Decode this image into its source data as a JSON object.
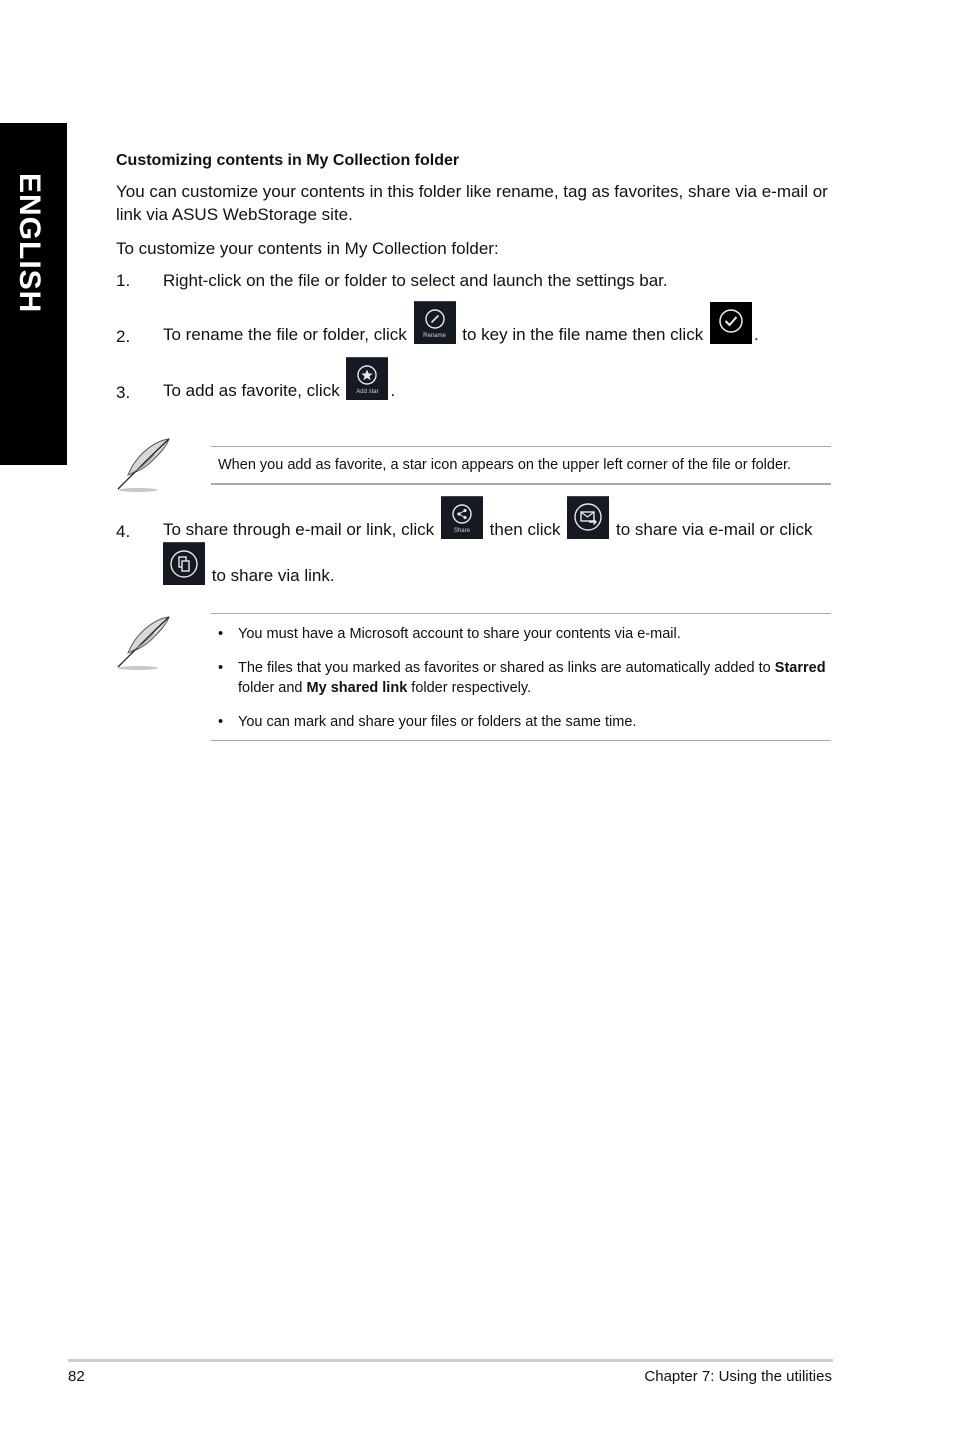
{
  "side_tab": {
    "label": "ENGLISH"
  },
  "section": {
    "heading": "Customizing contents in My Collection folder",
    "intro": "You can customize your contents in this folder like rename, tag as favorites, share via e-mail or link via ASUS WebStorage site.",
    "lead": "To customize your contents in My Collection folder:"
  },
  "steps": [
    {
      "num": "1.",
      "text": "Right-click on the file or folder to select and launch the settings bar."
    },
    {
      "num": "2.",
      "text_a": "To rename the file or folder, click",
      "text_b": "to key in the file name then click",
      "text_c": ".",
      "icon_a": {
        "name": "rename-icon",
        "caption": "Rename"
      },
      "icon_b": {
        "name": "checkmark-icon"
      }
    },
    {
      "num": "3.",
      "text_a": "To add as favorite, click",
      "text_b": ".",
      "icon_a": {
        "name": "add-star-icon",
        "caption": "Add star"
      }
    },
    {
      "num": "4.",
      "text_a": "To share through e-mail or link, click",
      "text_b": "then click",
      "text_c": "to share via e-mail or click",
      "text_d": "to share via link.",
      "icon_a": {
        "name": "share-icon",
        "caption": "Share"
      },
      "icon_b": {
        "name": "email-share-icon"
      },
      "icon_c": {
        "name": "link-share-icon"
      }
    }
  ],
  "note1": {
    "icon": "feather-pen-icon",
    "text": "When you add as favorite, a star icon appears on the upper left corner of the file or folder."
  },
  "note2": {
    "icon": "feather-pen-icon",
    "bullet": "•",
    "items": [
      {
        "text": "You must have a Microsoft account to share your contents via e-mail."
      },
      {
        "pre": "The files that you marked as favorites or shared as links are automatically added to ",
        "bold1": "Starred",
        "mid": " folder and ",
        "bold2": "My shared link",
        "post": " folder respectively."
      },
      {
        "text": "You can mark and share your files or folders at the same time."
      }
    ]
  },
  "footer": {
    "page_number": "82",
    "chapter": "Chapter 7: Using the utilities"
  }
}
